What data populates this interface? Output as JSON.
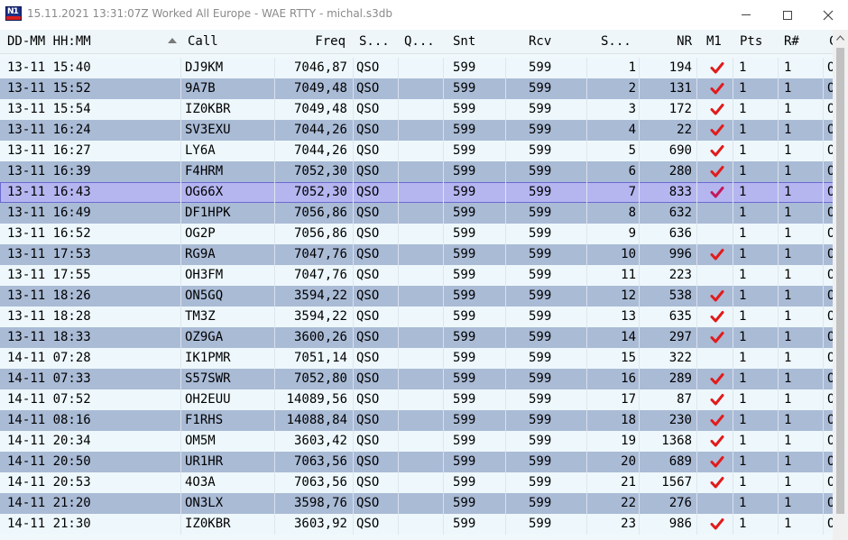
{
  "window": {
    "title": "15.11.2021 13:31:07Z  Worked All Europe - WAE RTTY - michal.s3db",
    "icon_text": "N1"
  },
  "columns": [
    {
      "key": "datetime",
      "label": "DD-MM HH:MM"
    },
    {
      "key": "call",
      "label": "Call"
    },
    {
      "key": "freq",
      "label": "Freq"
    },
    {
      "key": "s1",
      "label": "S..."
    },
    {
      "key": "q",
      "label": "Q..."
    },
    {
      "key": "snt",
      "label": "Snt"
    },
    {
      "key": "rcv",
      "label": "Rcv"
    },
    {
      "key": "s2",
      "label": "S..."
    },
    {
      "key": "nr",
      "label": "NR"
    },
    {
      "key": "m1",
      "label": "M1"
    },
    {
      "key": "pts",
      "label": "Pts"
    },
    {
      "key": "r",
      "label": "R#"
    },
    {
      "key": "o",
      "label": "C"
    }
  ],
  "colors": {
    "row_odd": "#eef8fc",
    "row_even": "#aabbd6",
    "row_selected": "#b5b6f0",
    "check_red": "#e11b1b"
  },
  "selected_row": 6,
  "rows": [
    {
      "datetime": "13-11 15:40",
      "call": "DJ9KM",
      "freq": "7046,87",
      "s1": "QSO",
      "q": "",
      "snt": "599",
      "rcv": "599",
      "s2": "1",
      "nr": "194",
      "m1": true,
      "pts": "1",
      "r": "1",
      "o": "O.."
    },
    {
      "datetime": "13-11 15:52",
      "call": "9A7B",
      "freq": "7049,48",
      "s1": "QSO",
      "q": "",
      "snt": "599",
      "rcv": "599",
      "s2": "2",
      "nr": "131",
      "m1": true,
      "pts": "1",
      "r": "1",
      "o": "O.."
    },
    {
      "datetime": "13-11 15:54",
      "call": "IZ0KBR",
      "freq": "7049,48",
      "s1": "QSO",
      "q": "",
      "snt": "599",
      "rcv": "599",
      "s2": "3",
      "nr": "172",
      "m1": true,
      "pts": "1",
      "r": "1",
      "o": "O.."
    },
    {
      "datetime": "13-11 16:24",
      "call": "SV3EXU",
      "freq": "7044,26",
      "s1": "QSO",
      "q": "",
      "snt": "599",
      "rcv": "599",
      "s2": "4",
      "nr": "22",
      "m1": true,
      "pts": "1",
      "r": "1",
      "o": "O.."
    },
    {
      "datetime": "13-11 16:27",
      "call": "LY6A",
      "freq": "7044,26",
      "s1": "QSO",
      "q": "",
      "snt": "599",
      "rcv": "599",
      "s2": "5",
      "nr": "690",
      "m1": true,
      "pts": "1",
      "r": "1",
      "o": "O.."
    },
    {
      "datetime": "13-11 16:39",
      "call": "F4HRM",
      "freq": "7052,30",
      "s1": "QSO",
      "q": "",
      "snt": "599",
      "rcv": "599",
      "s2": "6",
      "nr": "280",
      "m1": true,
      "pts": "1",
      "r": "1",
      "o": "O.."
    },
    {
      "datetime": "13-11 16:43",
      "call": "OG66X",
      "freq": "7052,30",
      "s1": "QSO",
      "q": "",
      "snt": "599",
      "rcv": "599",
      "s2": "7",
      "nr": "833",
      "m1": true,
      "pts": "1",
      "r": "1",
      "o": "O.."
    },
    {
      "datetime": "13-11 16:49",
      "call": "DF1HPK",
      "freq": "7056,86",
      "s1": "QSO",
      "q": "",
      "snt": "599",
      "rcv": "599",
      "s2": "8",
      "nr": "632",
      "m1": false,
      "pts": "1",
      "r": "1",
      "o": "O.."
    },
    {
      "datetime": "13-11 16:52",
      "call": "OG2P",
      "freq": "7056,86",
      "s1": "QSO",
      "q": "",
      "snt": "599",
      "rcv": "599",
      "s2": "9",
      "nr": "636",
      "m1": false,
      "pts": "1",
      "r": "1",
      "o": "O.."
    },
    {
      "datetime": "13-11 17:53",
      "call": "RG9A",
      "freq": "7047,76",
      "s1": "QSO",
      "q": "",
      "snt": "599",
      "rcv": "599",
      "s2": "10",
      "nr": "996",
      "m1": true,
      "pts": "1",
      "r": "1",
      "o": "O.."
    },
    {
      "datetime": "13-11 17:55",
      "call": "OH3FM",
      "freq": "7047,76",
      "s1": "QSO",
      "q": "",
      "snt": "599",
      "rcv": "599",
      "s2": "11",
      "nr": "223",
      "m1": false,
      "pts": "1",
      "r": "1",
      "o": "O.."
    },
    {
      "datetime": "13-11 18:26",
      "call": "ON5GQ",
      "freq": "3594,22",
      "s1": "QSO",
      "q": "",
      "snt": "599",
      "rcv": "599",
      "s2": "12",
      "nr": "538",
      "m1": true,
      "pts": "1",
      "r": "1",
      "o": "O.."
    },
    {
      "datetime": "13-11 18:28",
      "call": "TM3Z",
      "freq": "3594,22",
      "s1": "QSO",
      "q": "",
      "snt": "599",
      "rcv": "599",
      "s2": "13",
      "nr": "635",
      "m1": true,
      "pts": "1",
      "r": "1",
      "o": "O.."
    },
    {
      "datetime": "13-11 18:33",
      "call": "OZ9GA",
      "freq": "3600,26",
      "s1": "QSO",
      "q": "",
      "snt": "599",
      "rcv": "599",
      "s2": "14",
      "nr": "297",
      "m1": true,
      "pts": "1",
      "r": "1",
      "o": "O.."
    },
    {
      "datetime": "14-11 07:28",
      "call": "IK1PMR",
      "freq": "7051,14",
      "s1": "QSO",
      "q": "",
      "snt": "599",
      "rcv": "599",
      "s2": "15",
      "nr": "322",
      "m1": false,
      "pts": "1",
      "r": "1",
      "o": "O.."
    },
    {
      "datetime": "14-11 07:33",
      "call": "S57SWR",
      "freq": "7052,80",
      "s1": "QSO",
      "q": "",
      "snt": "599",
      "rcv": "599",
      "s2": "16",
      "nr": "289",
      "m1": true,
      "pts": "1",
      "r": "1",
      "o": "O.."
    },
    {
      "datetime": "14-11 07:52",
      "call": "OH2EUU",
      "freq": "14089,56",
      "s1": "QSO",
      "q": "",
      "snt": "599",
      "rcv": "599",
      "s2": "17",
      "nr": "87",
      "m1": true,
      "pts": "1",
      "r": "1",
      "o": "O.."
    },
    {
      "datetime": "14-11 08:16",
      "call": "F1RHS",
      "freq": "14088,84",
      "s1": "QSO",
      "q": "",
      "snt": "599",
      "rcv": "599",
      "s2": "18",
      "nr": "230",
      "m1": true,
      "pts": "1",
      "r": "1",
      "o": "O.."
    },
    {
      "datetime": "14-11 20:34",
      "call": "OM5M",
      "freq": "3603,42",
      "s1": "QSO",
      "q": "",
      "snt": "599",
      "rcv": "599",
      "s2": "19",
      "nr": "1368",
      "m1": true,
      "pts": "1",
      "r": "1",
      "o": "O.."
    },
    {
      "datetime": "14-11 20:50",
      "call": "UR1HR",
      "freq": "7063,56",
      "s1": "QSO",
      "q": "",
      "snt": "599",
      "rcv": "599",
      "s2": "20",
      "nr": "689",
      "m1": true,
      "pts": "1",
      "r": "1",
      "o": "O.."
    },
    {
      "datetime": "14-11 20:53",
      "call": "4O3A",
      "freq": "7063,56",
      "s1": "QSO",
      "q": "",
      "snt": "599",
      "rcv": "599",
      "s2": "21",
      "nr": "1567",
      "m1": true,
      "pts": "1",
      "r": "1",
      "o": "O.."
    },
    {
      "datetime": "14-11 21:20",
      "call": "ON3LX",
      "freq": "3598,76",
      "s1": "QSO",
      "q": "",
      "snt": "599",
      "rcv": "599",
      "s2": "22",
      "nr": "276",
      "m1": false,
      "pts": "1",
      "r": "1",
      "o": "O.."
    },
    {
      "datetime": "14-11 21:30",
      "call": "IZ0KBR",
      "freq": "3603,92",
      "s1": "QSO",
      "q": "",
      "snt": "599",
      "rcv": "599",
      "s2": "23",
      "nr": "986",
      "m1": true,
      "pts": "1",
      "r": "1",
      "o": "O.."
    }
  ]
}
